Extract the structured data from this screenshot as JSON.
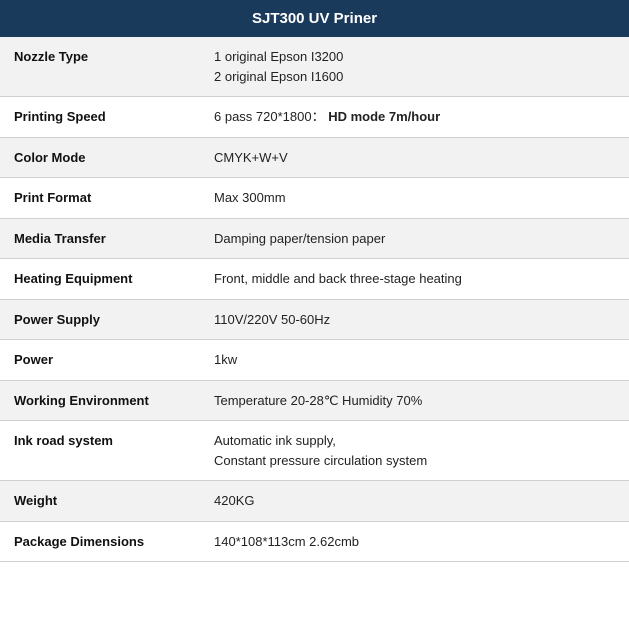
{
  "title": "SJT300 UV Priner",
  "rows": [
    {
      "label": "Nozzle Type",
      "value": "1 original Epson I3200\n2 original Epson I1600",
      "value_parts": [
        "1 original Epson I3200",
        "2 original Epson I1600"
      ],
      "bold_part": null
    },
    {
      "label": "Printing Speed",
      "value": "6 pass 720*1800： HD mode 7m/hour",
      "value_parts": [
        "6 pass 720*1800： "
      ],
      "bold_part": "HD mode 7m/hour"
    },
    {
      "label": "Color Mode",
      "value": "CMYK+W+V",
      "value_parts": [
        "CMYK+W+V"
      ],
      "bold_part": null
    },
    {
      "label": "Print Format",
      "value": "Max 300mm",
      "value_parts": [
        "Max 300mm"
      ],
      "bold_part": null
    },
    {
      "label": "Media Transfer",
      "value": "Damping paper/tension paper",
      "value_parts": [
        "Damping paper/tension paper"
      ],
      "bold_part": null
    },
    {
      "label": "Heating Equipment",
      "value": "Front, middle and back three-stage heating",
      "value_parts": [
        "Front, middle and back three-stage heating"
      ],
      "bold_part": null
    },
    {
      "label": "Power Supply",
      "value": "110V/220V 50-60Hz",
      "value_parts": [
        "110V/220V 50-60Hz"
      ],
      "bold_part": null
    },
    {
      "label": "Power",
      "value": "1kw",
      "value_parts": [
        "1kw"
      ],
      "bold_part": null
    },
    {
      "label": "Working Environment",
      "value": "Temperature 20-28℃  Humidity 70%",
      "value_parts": [
        "Temperature 20-28℃  Humidity 70%"
      ],
      "bold_part": null
    },
    {
      "label": "Ink road system",
      "value": "Automatic ink supply,\nConstant pressure circulation system",
      "value_parts": [
        "Automatic ink supply,",
        "Constant pressure circulation system"
      ],
      "bold_part": null
    },
    {
      "label": "Weight",
      "value": "420KG",
      "value_parts": [
        "420KG"
      ],
      "bold_part": null
    },
    {
      "label": "Package Dimensions",
      "value": "140*108*113cm  2.62cmb",
      "value_parts": [
        "140*108*113cm  2.62cmb"
      ],
      "bold_part": null
    }
  ]
}
